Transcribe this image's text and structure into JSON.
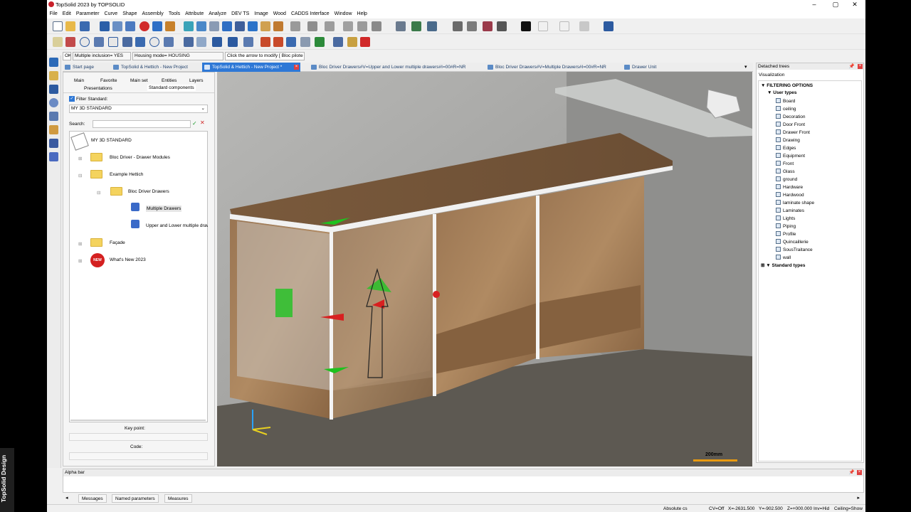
{
  "window": {
    "title": "TopSolid 2023 by TOPSOLID"
  },
  "menu": [
    "File",
    "Edit",
    "Parameter",
    "Curve",
    "Shape",
    "Assembly",
    "Tools",
    "Attribute",
    "Analyze",
    "DEV TS",
    "Image",
    "Wood",
    "CADDS Interface",
    "Window",
    "Help"
  ],
  "props": {
    "ok_label": "OK",
    "multiple_label": "Multiple inclusion=",
    "multiple_value": "YES",
    "housing_label": "Housing mode=",
    "housing_value": "HOUSING",
    "prompt": "Click the arrow to modify [ Bloc pilote"
  },
  "doc_tabs": [
    "Start page",
    "TopSolid & Hettich - New Project",
    "TopSolid & Hettich - New Project *",
    "Bloc Driver Drawers#V=Upper and Lower multiple drawers#I=00#R=NR",
    "Bloc Driver Drawers#V=Multiple Drawers#I=00#R=NR",
    "Drawer Unit"
  ],
  "left_panel": {
    "tabs_row1": [
      "Main",
      "Favorite",
      "Main set",
      "Entities",
      "Layers"
    ],
    "tabs_row2": [
      "Presentations",
      "Standard components"
    ],
    "filter_label": "Filter  Standard:",
    "standard_value": "MY 3D STANDARD",
    "search_label": "Search:",
    "tree": {
      "root": "MY 3D STANDARD",
      "nodes": [
        "Bloc Driver - Drawer Modules",
        "Example Hettich",
        "Bloc Driver Drawers",
        "Multiple Drawers",
        "Upper and Lower multiple drawers",
        "Façade",
        "What's New 2023"
      ]
    },
    "key_point_label": "Key point:",
    "code_label": "Code:"
  },
  "viewport": {
    "scale_label": "200mm"
  },
  "right_panel": {
    "title": "Detached trees",
    "subtitle": "Visualization",
    "filtering": "FILTERING OPTIONS",
    "user_types": "User types",
    "items": [
      "Board",
      "ceiling",
      "Decoration",
      "Door Front",
      "Drawer Front",
      "Drawing",
      "Edges",
      "Equipment",
      "Front",
      "Glass",
      "ground",
      "Hardware",
      "Hardwood",
      "laminate shape",
      "Laminates",
      "Lights",
      "Piping",
      "Profile",
      "Quincaillerie",
      "SousTraitance",
      "wall"
    ],
    "standard_types": "Standard types"
  },
  "alpha_bar": {
    "title": "Alpha bar"
  },
  "bottom_tabs": [
    "Messages",
    "Named parameters",
    "Measures"
  ],
  "status": {
    "cs": "Absolute cs",
    "cv": "CV=Off",
    "x": "X=-2631.500",
    "y": "Y=-902.500",
    "z": "Z=+000.000",
    "inv": "Inv=Hid",
    "ceiling": "Ceiling=Show"
  },
  "brand": "TopSolid Design"
}
